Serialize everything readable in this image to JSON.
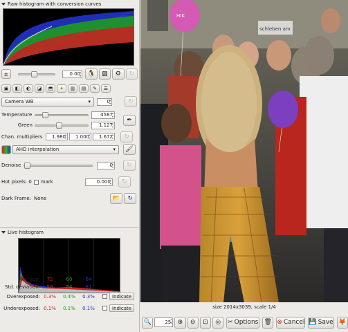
{
  "raw_histogram": {
    "title": "Raw histogram with conversion curves"
  },
  "exposure": {
    "value": "0.00"
  },
  "wb": {
    "preset": "Camera WB",
    "preset_spin": "0",
    "temperature_label": "Temperature",
    "temperature_value": "4587",
    "green_label": "Green",
    "green_value": "1.127",
    "multipliers_label": "Chan. multipliers",
    "mult_r": "1.980",
    "mult_g": "1.000",
    "mult_b": "1.672"
  },
  "interpolation": {
    "value": "AHD interpolation"
  },
  "denoise": {
    "label": "Denoise",
    "value": "0"
  },
  "hotpixels": {
    "label": "Hot pixels: 0",
    "mark_label": "mark",
    "value": "0.000"
  },
  "darkframe": {
    "label": "Dark Frame:",
    "value": "None"
  },
  "live_histogram": {
    "title": "Live histogram",
    "average_label": "Average:",
    "average": [
      "72",
      "60",
      "64"
    ],
    "stddev_label": "Std. deviation:",
    "stddev": [
      "59",
      "54",
      "61"
    ],
    "overexposed_label": "Overexposed:",
    "overexposed": [
      "0.3%",
      "0.4%",
      "0.3%"
    ],
    "underexposed_label": "Underexposed:",
    "underexposed": [
      "0.1%",
      "0.1%",
      "0.1%"
    ],
    "indicate_label": "Indicate"
  },
  "image": {
    "balloon_text": "HIK",
    "banner_text": "schleben am"
  },
  "status": {
    "size_text": "size 2014x3039, scale 1/4",
    "zoom_value": "25",
    "options_label": "Options",
    "cancel_label": "Cancel",
    "save_label": "Save"
  },
  "colors": {
    "red": "#d22222",
    "green": "#1f9b1f",
    "blue": "#2233cc",
    "hist_bg": "#000000"
  }
}
